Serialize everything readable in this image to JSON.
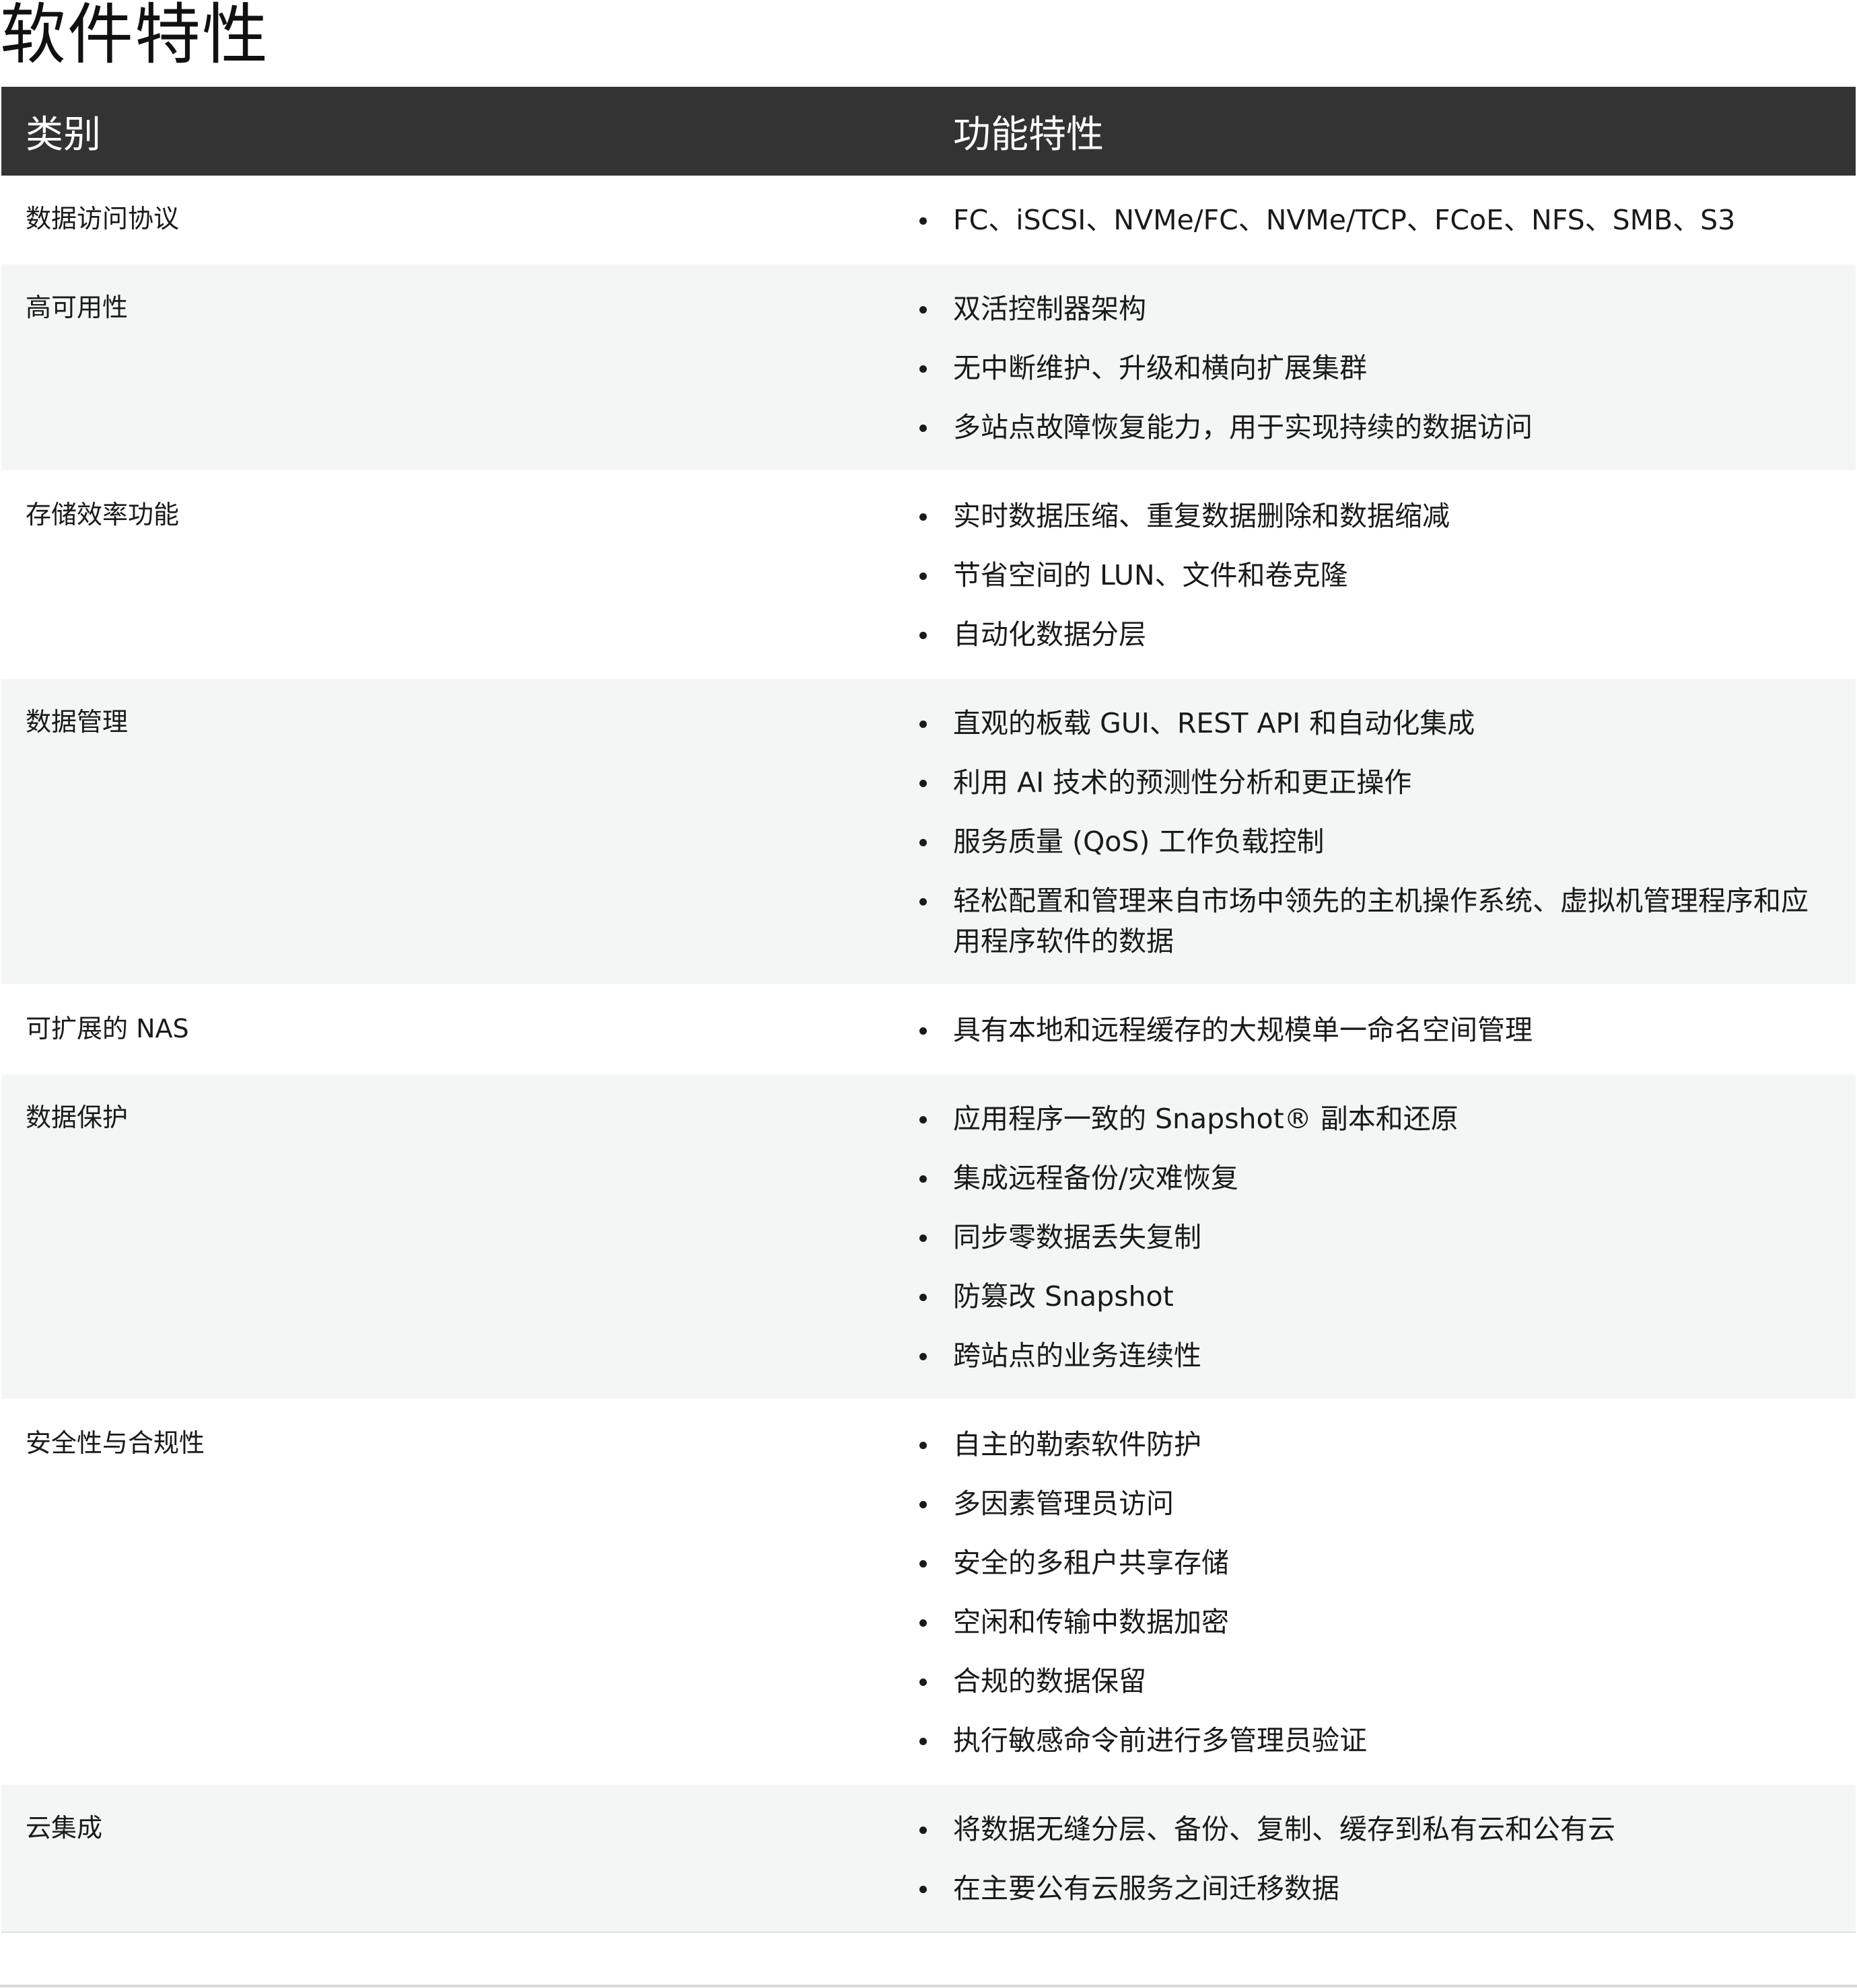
{
  "page": {
    "title": "软件特性"
  },
  "table": {
    "headers": [
      "类别",
      "功能特性"
    ],
    "rows": [
      {
        "category": "数据访问协议",
        "features": [
          "FC、iSCSI、NVMe/FC、NVMe/TCP、FCoE、NFS、SMB、S3"
        ]
      },
      {
        "category": "高可用性",
        "features": [
          "双活控制器架构",
          "无中断维护、升级和横向扩展集群",
          "多站点故障恢复能力，用于实现持续的数据访问"
        ]
      },
      {
        "category": "存储效率功能",
        "features": [
          "实时数据压缩、重复数据删除和数据缩减",
          "节省空间的 LUN、文件和卷克隆",
          "自动化数据分层"
        ]
      },
      {
        "category": "数据管理",
        "features": [
          "直观的板载 GUI、REST API 和自动化集成",
          "利用 AI 技术的预测性分析和更正操作",
          "服务质量 (QoS) 工作负载控制",
          "轻松配置和管理来自市场中领先的主机操作系统、虚拟机管理程序和应用程序软件的数据"
        ]
      },
      {
        "category": "可扩展的 NAS",
        "features": [
          "具有本地和远程缓存的大规模单一命名空间管理"
        ]
      },
      {
        "category": "数据保护",
        "features": [
          "应用程序一致的 Snapshot® 副本和还原",
          "集成远程备份/灾难恢复",
          "同步零数据丢失复制",
          "防篡改 Snapshot",
          "跨站点的业务连续性"
        ]
      },
      {
        "category": "安全性与合规性",
        "features": [
          "自主的勒索软件防护",
          "多因素管理员访问",
          "安全的多租户共享存储",
          "空闲和传输中数据加密",
          "合规的数据保留",
          "执行敏感命令前进行多管理员验证"
        ]
      },
      {
        "category": "云集成",
        "features": [
          "将数据无缝分层、备份、复制、缓存到私有云和公有云",
          "在主要公有云服务之间迁移数据"
        ]
      }
    ]
  },
  "colors": {
    "header_bg": "#333333",
    "header_text": "#ffffff",
    "row_alt_bg": "#f4f6f6",
    "text": "#1a1a1a"
  }
}
